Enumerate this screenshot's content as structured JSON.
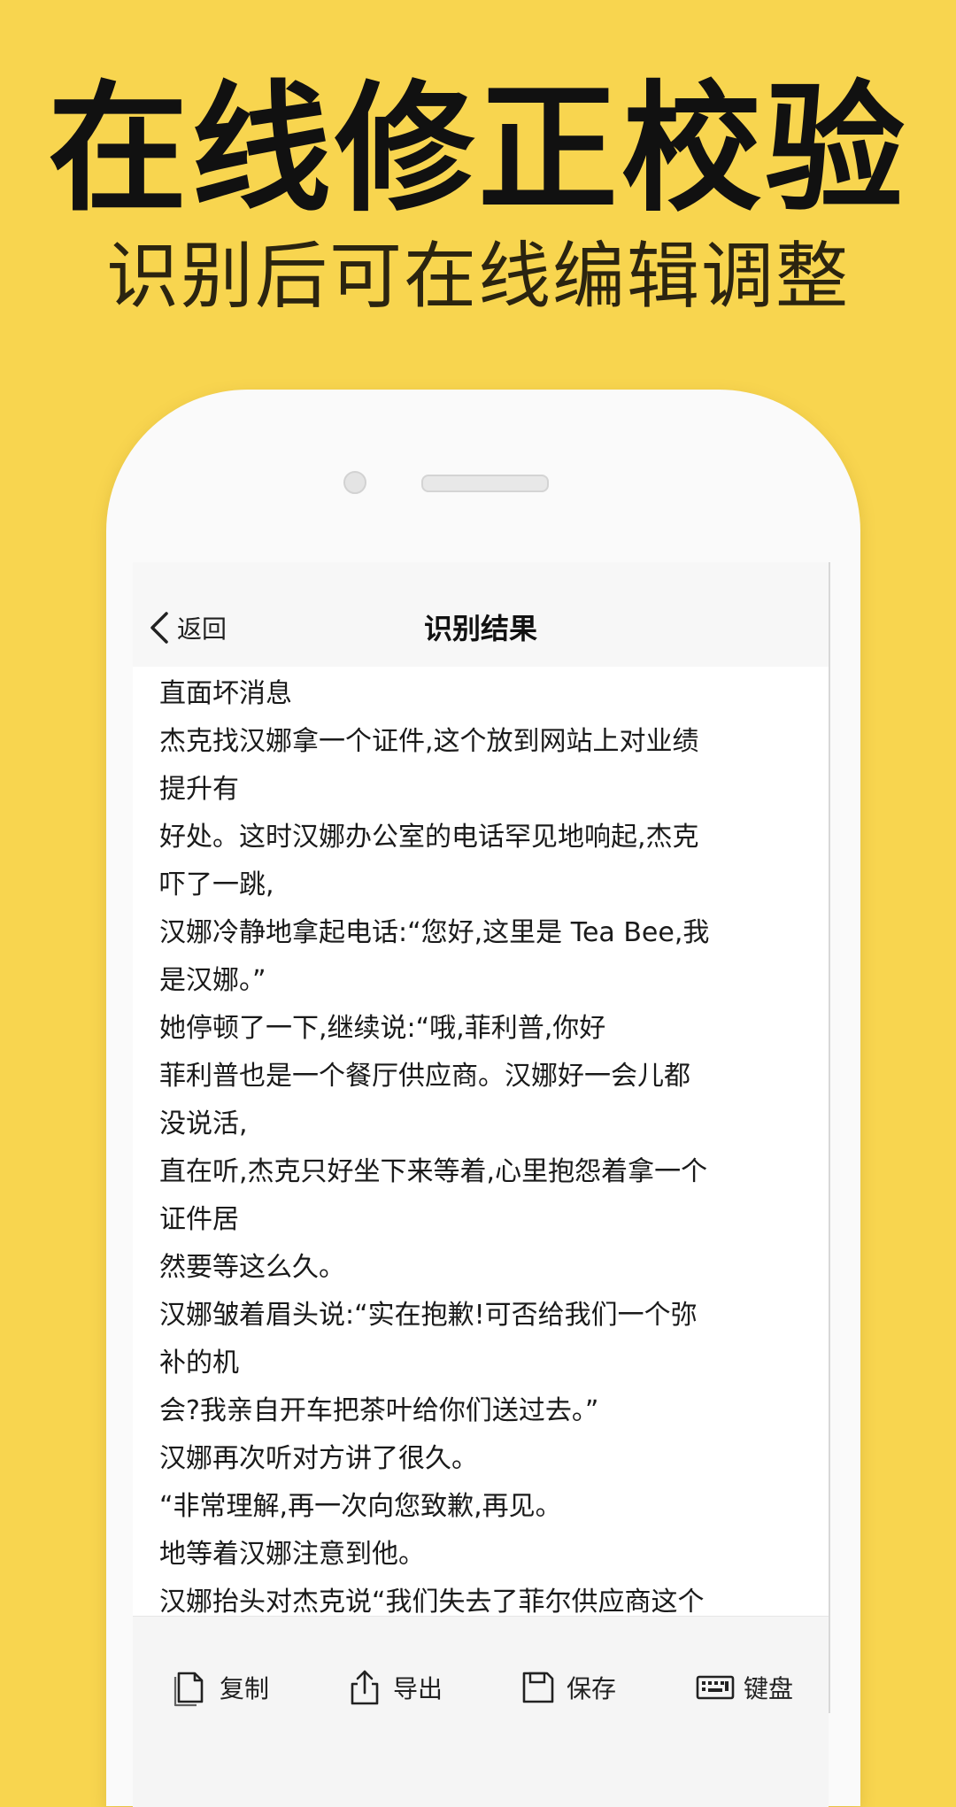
{
  "promo": {
    "title": "在线修正校验",
    "subtitle": "识别后可在线编辑调整"
  },
  "navbar": {
    "back_label": "返回",
    "title": "识别结果"
  },
  "content": {
    "lines": [
      "直面坏消息",
      "杰克找汉娜拿一个证件,这个放到网站上对业绩",
      "提升有",
      "好处。这时汉娜办公室的电话罕见地响起,杰克",
      "吓了一跳,",
      "汉娜冷静地拿起电话:“您好,这里是 Tea Bee,我",
      "是汉娜。”",
      "她停顿了一下,继续说:“哦,菲利普,你好",
      "菲利普也是一个餐厅供应商。汉娜好一会儿都",
      "没说活,",
      "直在听,杰克只好坐下来等着,心里抱怨着拿一个",
      "证件居",
      "然要等这么久。",
      "汉娜皱着眉头说:“实在抱歉!可否给我们一个弥",
      "补的机",
      "会?我亲自开车把茶叶给你们送过去。”",
      "汉娜再次听对方讲了很久。",
      "“非常理解,再一次向您致歉,再见。",
      "地等着汉娜注意到他。",
      "汉娜抬头对杰克说“我们失去了菲尔供应商这个"
    ]
  },
  "toolbar": {
    "copy_label": "复制",
    "export_label": "导出",
    "save_label": "保存",
    "keyboard_label": "键盘"
  },
  "icons": {
    "back": "chevron-left-icon",
    "copy": "copy-document-icon",
    "export": "share-export-icon",
    "save": "save-icon",
    "keyboard": "keyboard-icon"
  },
  "colors": {
    "background": "#f8d54f",
    "title_text": "#111111",
    "subtitle_text": "#2b2410"
  }
}
